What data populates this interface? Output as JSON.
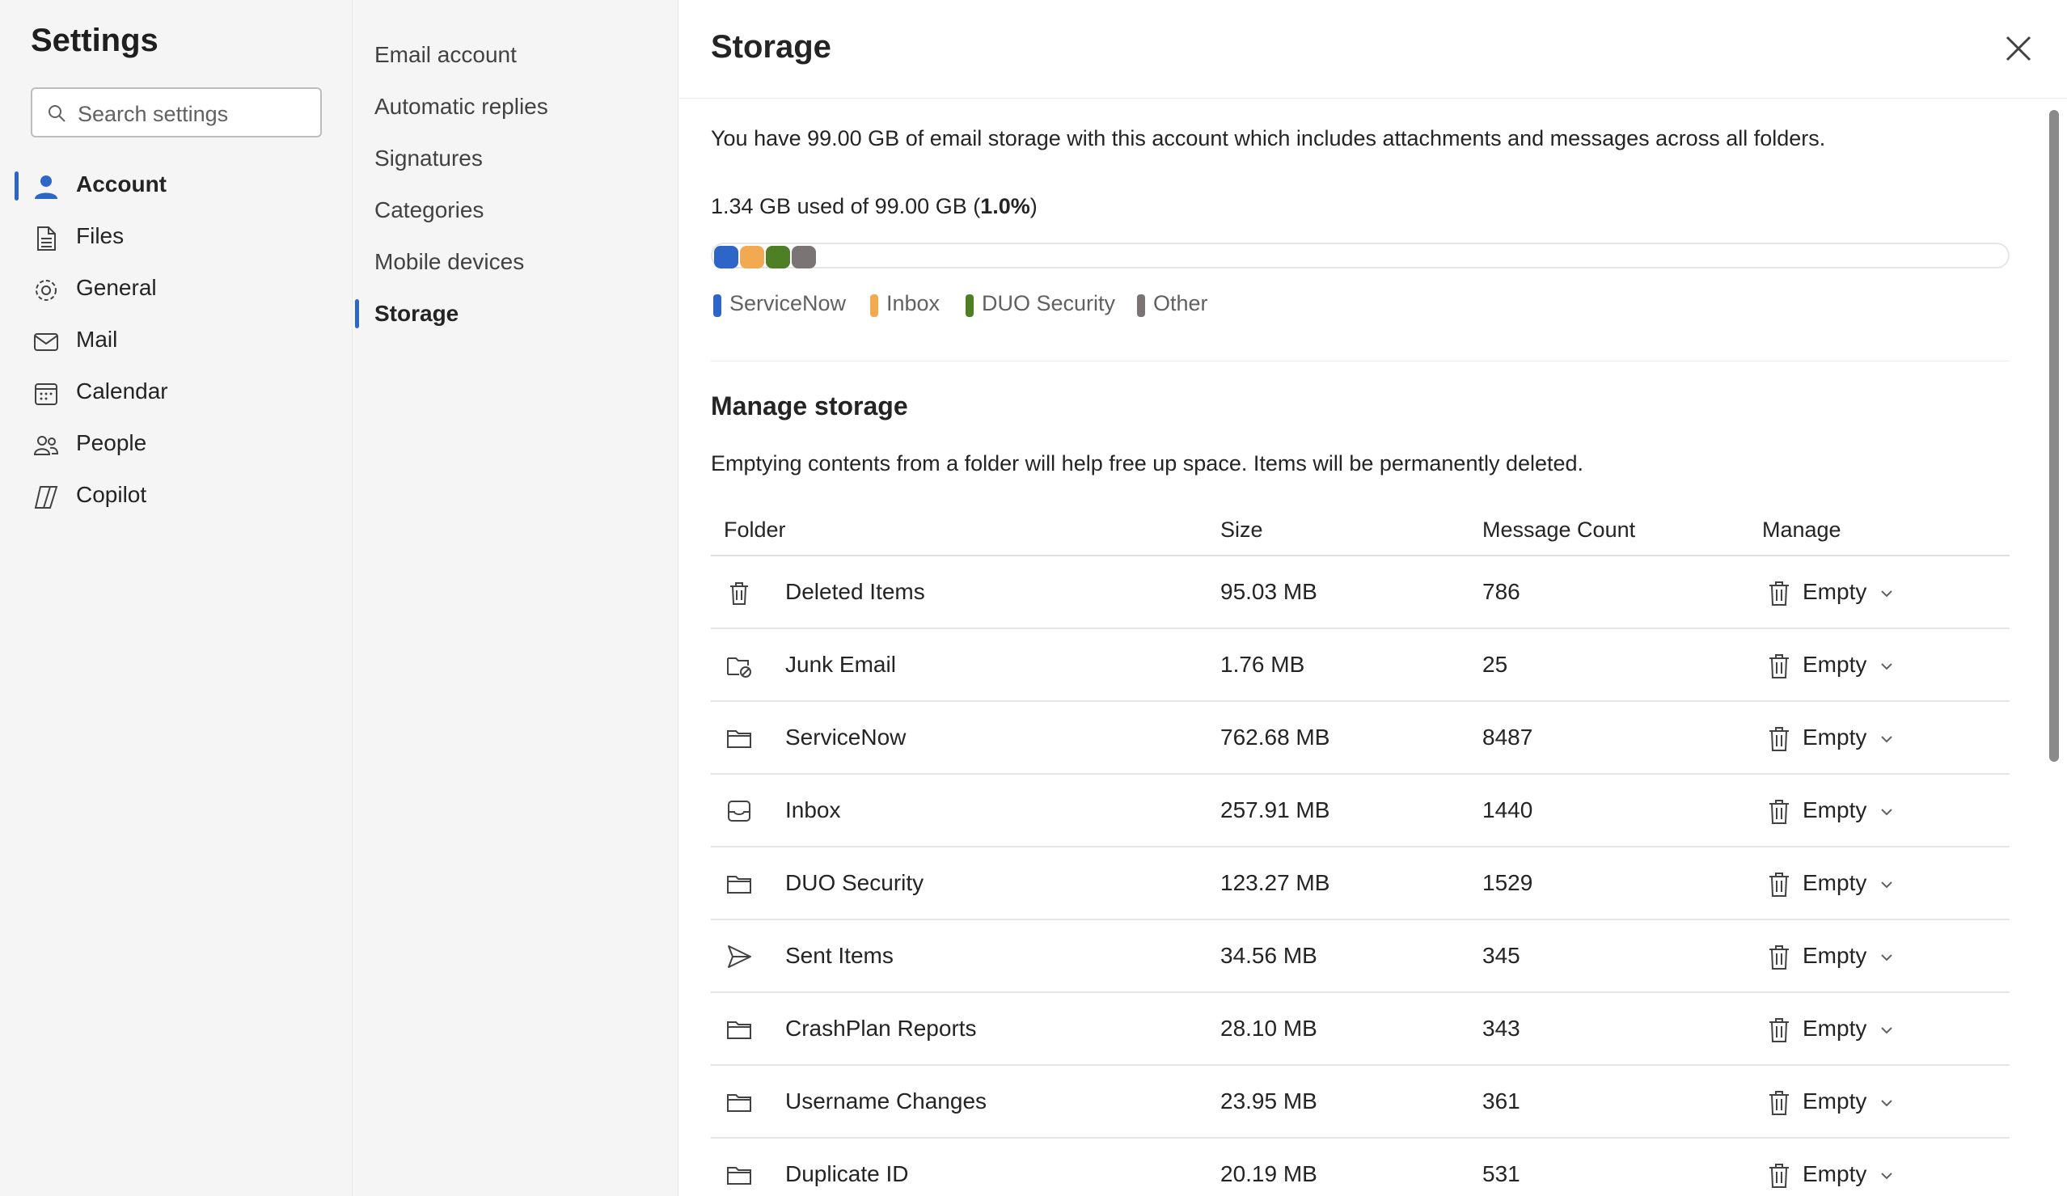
{
  "nav": {
    "title": "Settings",
    "search_placeholder": "Search settings",
    "items": [
      {
        "label": "Account",
        "icon": "person-icon",
        "active": true
      },
      {
        "label": "Files",
        "icon": "file-icon"
      },
      {
        "label": "General",
        "icon": "gear-icon"
      },
      {
        "label": "Mail",
        "icon": "mail-icon"
      },
      {
        "label": "Calendar",
        "icon": "calendar-icon"
      },
      {
        "label": "People",
        "icon": "people-icon"
      },
      {
        "label": "Copilot",
        "icon": "copilot-icon"
      }
    ]
  },
  "subnav": {
    "items": [
      {
        "label": "Email account"
      },
      {
        "label": "Automatic replies"
      },
      {
        "label": "Signatures"
      },
      {
        "label": "Categories"
      },
      {
        "label": "Mobile devices"
      },
      {
        "label": "Storage",
        "active": true
      }
    ]
  },
  "main": {
    "title": "Storage",
    "description": "You have 99.00 GB of email storage with this account which includes attachments and messages across all folders.",
    "usage_prefix": "1.34 GB used of 99.00 GB (",
    "usage_percent": "1.0%",
    "usage_suffix": ")",
    "usage_fraction": 0.01,
    "legend": [
      {
        "label": "ServiceNow",
        "color": "#2e66c7"
      },
      {
        "label": "Inbox",
        "color": "#f2a950"
      },
      {
        "label": "DUO Security",
        "color": "#4f7f24"
      },
      {
        "label": "Other",
        "color": "#7a7574"
      }
    ],
    "manage": {
      "title": "Manage storage",
      "description": "Emptying contents from a folder will help free up space. Items will be permanently deleted.",
      "columns": {
        "folder": "Folder",
        "size": "Size",
        "count": "Message Count",
        "manage": "Manage"
      },
      "action_label": "Empty",
      "rows": [
        {
          "folder": "Deleted Items",
          "size": "95.03 MB",
          "count": "786",
          "icon": "trash-icon"
        },
        {
          "folder": "Junk Email",
          "size": "1.76 MB",
          "count": "25",
          "icon": "junk-folder-icon"
        },
        {
          "folder": "ServiceNow",
          "size": "762.68 MB",
          "count": "8487",
          "icon": "folder-icon"
        },
        {
          "folder": "Inbox",
          "size": "257.91 MB",
          "count": "1440",
          "icon": "inbox-icon"
        },
        {
          "folder": "DUO Security",
          "size": "123.27 MB",
          "count": "1529",
          "icon": "folder-icon"
        },
        {
          "folder": "Sent Items",
          "size": "34.56 MB",
          "count": "345",
          "icon": "send-icon"
        },
        {
          "folder": "CrashPlan Reports",
          "size": "28.10 MB",
          "count": "343",
          "icon": "folder-icon"
        },
        {
          "folder": "Username Changes",
          "size": "23.95 MB",
          "count": "361",
          "icon": "folder-icon"
        },
        {
          "folder": "Duplicate ID",
          "size": "20.19 MB",
          "count": "531",
          "icon": "folder-icon"
        }
      ]
    }
  }
}
